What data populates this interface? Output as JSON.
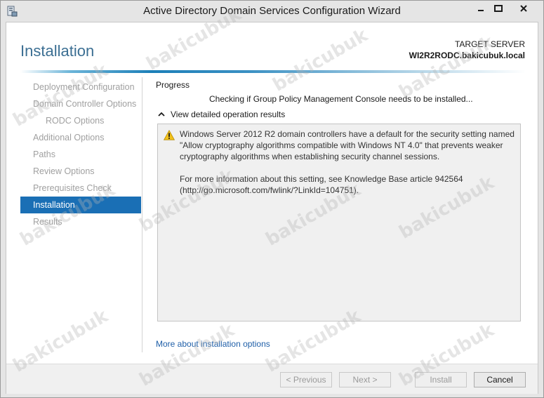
{
  "window": {
    "title": "Active Directory Domain Services Configuration Wizard"
  },
  "header": {
    "page_title": "Installation",
    "target_label": "TARGET SERVER",
    "target_server": "WI2R2RODC.bakicubuk.local"
  },
  "sidebar": {
    "items": [
      {
        "label": "Deployment Configuration",
        "state": "done"
      },
      {
        "label": "Domain Controller Options",
        "state": "done"
      },
      {
        "label": "RODC Options",
        "state": "done"
      },
      {
        "label": "Additional Options",
        "state": "done"
      },
      {
        "label": "Paths",
        "state": "done"
      },
      {
        "label": "Review Options",
        "state": "done"
      },
      {
        "label": "Prerequisites Check",
        "state": "done"
      },
      {
        "label": "Installation",
        "state": "active"
      },
      {
        "label": "Results",
        "state": "pending"
      }
    ]
  },
  "main": {
    "progress_label": "Progress",
    "status_text": "Checking if Group Policy Management Console needs to be installed...",
    "details_toggle_label": "View detailed operation results",
    "details": {
      "warning_icon": "warning-icon",
      "paragraph1": "Windows Server 2012 R2 domain controllers have a default for the security setting named \"Allow cryptography algorithms compatible with Windows NT 4.0\" that prevents weaker cryptography algorithms when establishing security channel sessions.",
      "paragraph2": "For more information about this setting, see Knowledge Base article 942564 (http://go.microsoft.com/fwlink/?LinkId=104751)."
    },
    "more_link": "More about installation options"
  },
  "footer": {
    "previous_label": "< Previous",
    "next_label": "Next >",
    "install_label": "Install",
    "cancel_label": "Cancel"
  },
  "watermark": "bakicubuk",
  "colors": {
    "accent": "#1a6fb5",
    "title": "#3c6f93",
    "link": "#1f5fa8",
    "warning": "#f2c21b"
  }
}
